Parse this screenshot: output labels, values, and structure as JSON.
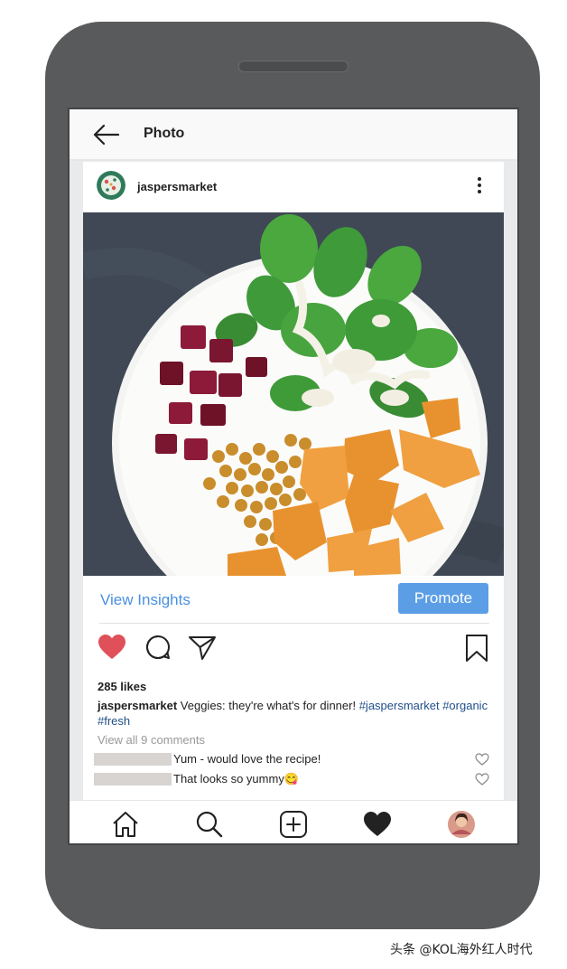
{
  "topbar": {
    "title": "Photo"
  },
  "post": {
    "username": "jaspersmarket",
    "insights_label": "View Insights",
    "promote_label": "Promote",
    "likes": "285 likes",
    "caption_user": "jaspersmarket",
    "caption_text": " Veggies: they're what's for dinner! ",
    "hashtags": [
      "#jaspersmarket",
      "#organic",
      "#fresh"
    ],
    "view_comments": "View all 9 comments",
    "comments": [
      {
        "text": "Yum - would love the recipe!"
      },
      {
        "text": "That looks so yummy😋"
      }
    ],
    "liked": true
  },
  "colors": {
    "accent": "#4a90e2",
    "promote_bg": "#5b9ee6",
    "like_red": "#e0505a",
    "hashtag": "#1f4f8a"
  },
  "icons": {
    "back": "back-arrow-icon",
    "more": "more-vertical-icon",
    "like": "heart-filled-icon",
    "comment": "comment-bubble-icon",
    "share": "send-icon",
    "save": "bookmark-icon",
    "nav": [
      "home-icon",
      "search-icon",
      "add-post-icon",
      "activity-heart-icon",
      "profile-avatar-icon"
    ]
  },
  "watermark": "头条 @KOL海外红人时代"
}
